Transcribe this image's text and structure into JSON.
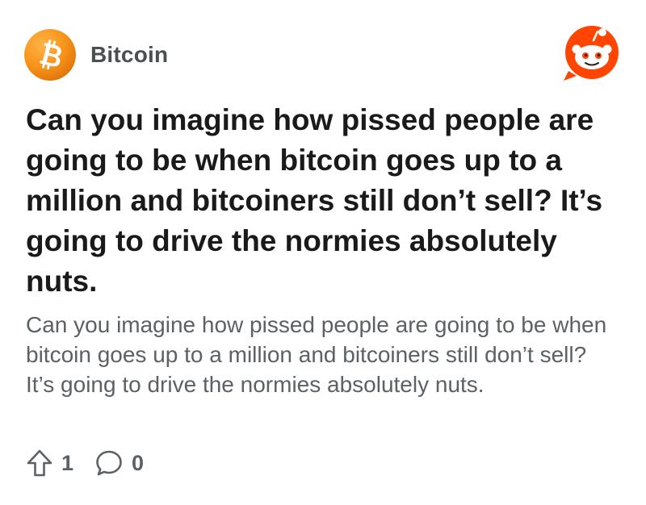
{
  "post": {
    "subreddit": "Bitcoin",
    "title": "Can you imagine how pissed people are going to be when bitcoin goes up to a million and bitcoiners still don’t sell? It’s going to drive the normies absolutely nuts.",
    "body": "Can you imagine how pissed people are going to be when bitcoin goes up to a million and bitcoiners still don’t sell? It’s going to drive the normies absolutely nuts.",
    "upvotes": "1",
    "comments": "0"
  },
  "icons": {
    "subreddit_avatar": "bitcoin-logo-icon",
    "brand": "reddit-logo-icon",
    "upvote": "upvote-arrow-icon",
    "comment": "comment-bubble-icon"
  },
  "colors": {
    "bitcoin_orange": "#f7931a",
    "reddit_orange": "#ff4500",
    "subreddit_name": "#4a4f52",
    "title": "#1a1a1b",
    "body": "#5b6165"
  }
}
